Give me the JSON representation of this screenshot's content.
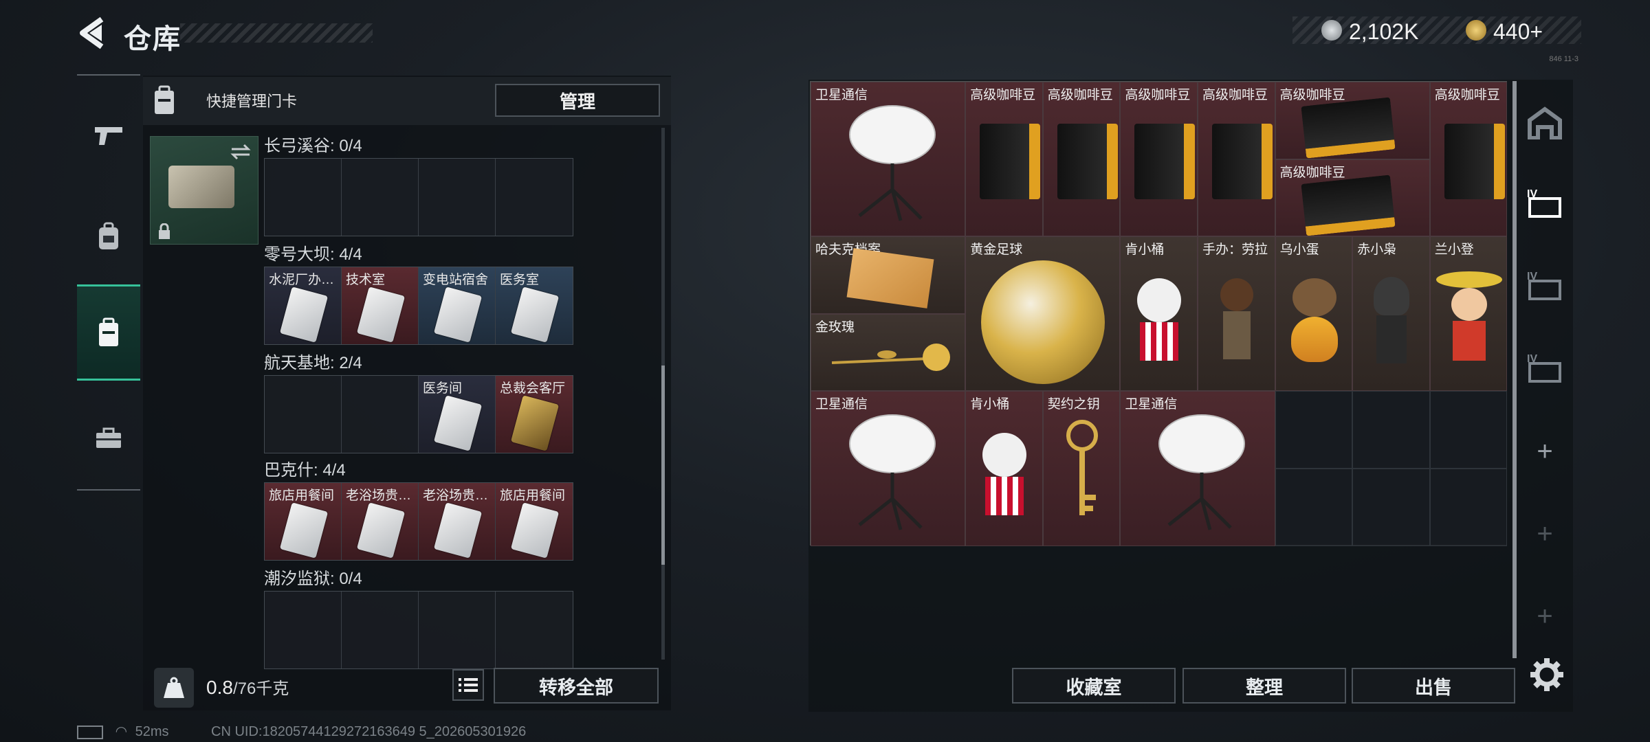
{
  "header": {
    "title": "仓库"
  },
  "currency": {
    "coins": "2,102K",
    "gold": "440+",
    "note": "846 11-3"
  },
  "left_nav": [
    "pistol-icon",
    "backpack-icon",
    "keycard-case-icon",
    "toolbox-icon"
  ],
  "quick": {
    "label": "快捷管理门卡",
    "manage_label": "管理"
  },
  "sections": [
    {
      "title": "长弓溪谷: 0/4",
      "cells": [
        {
          "label": "",
          "style": "empty"
        },
        {
          "label": "",
          "style": "empty"
        },
        {
          "label": "",
          "style": "empty"
        },
        {
          "label": "",
          "style": "empty"
        }
      ]
    },
    {
      "title": "零号大坝: 4/4",
      "cells": [
        {
          "label": "水泥厂办…",
          "style": "dark"
        },
        {
          "label": "技术室",
          "style": "red"
        },
        {
          "label": "变电站宿舍",
          "style": "blue"
        },
        {
          "label": "医务室",
          "style": "blue"
        }
      ]
    },
    {
      "title": "航天基地: 2/4",
      "cells": [
        {
          "label": "",
          "style": "empty"
        },
        {
          "label": "",
          "style": "empty"
        },
        {
          "label": "医务间",
          "style": "dark"
        },
        {
          "label": "总裁会客厅",
          "style": "red"
        }
      ]
    },
    {
      "title": "巴克什: 4/4",
      "cells": [
        {
          "label": "旅店用餐间",
          "style": "red"
        },
        {
          "label": "老浴场贵…",
          "style": "red"
        },
        {
          "label": "老浴场贵…",
          "style": "red"
        },
        {
          "label": "旅店用餐间",
          "style": "red"
        }
      ]
    },
    {
      "title": "潮汐监狱: 0/4",
      "cells": [
        {
          "label": "",
          "style": "empty"
        },
        {
          "label": "",
          "style": "empty"
        },
        {
          "label": "",
          "style": "empty"
        },
        {
          "label": "",
          "style": "empty"
        }
      ]
    }
  ],
  "weight": {
    "current": "0.8",
    "max": "/76千克"
  },
  "transfer_label": "转移全部",
  "stash_items": {
    "sat1": "卫星通信",
    "coffee1": "高级咖啡豆",
    "coffee2": "高级咖啡豆",
    "coffee3": "高级咖啡豆",
    "coffee4": "高级咖啡豆",
    "coffee5": "高级咖啡豆",
    "coffee6": "高级咖啡豆",
    "coffee7": "高级咖啡豆",
    "hafuke": "哈夫克档案",
    "rose": "金玫瑰",
    "goldball": "黄金足球",
    "kfc1": "肯小桶",
    "laura": "手办：劳拉",
    "egg": "乌小蛋",
    "owl": "赤小枭",
    "lan": "兰小登",
    "sat2": "卫星通信",
    "kfc2": "肯小桶",
    "key": "契约之钥",
    "sat3": "卫星通信"
  },
  "bottom_buttons": {
    "collection": "收藏室",
    "organize": "整理",
    "sell": "出售"
  },
  "footer": {
    "ping": "52ms",
    "uid": "CN UID:18205744129272163649 5_202605301926"
  },
  "colors": {
    "accent": "#36c29a",
    "rare_red": "#4e2a2f",
    "epic_brown": "#3f3530"
  }
}
